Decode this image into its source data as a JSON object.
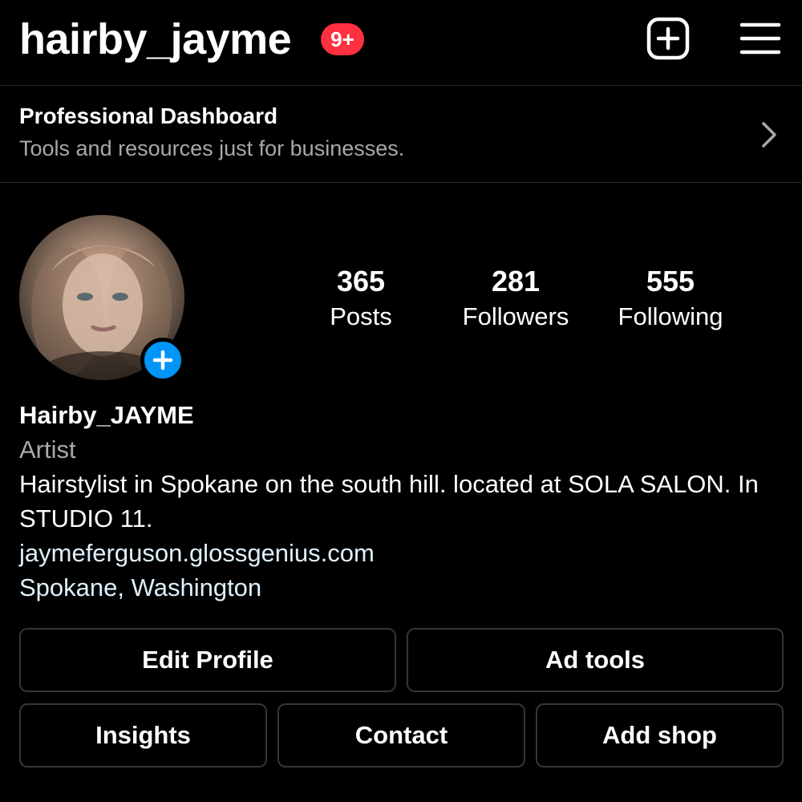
{
  "header": {
    "username": "hairby_jayme",
    "notification_badge": "9+",
    "badge_color": "#ff3040",
    "create_icon": "plus-square-icon",
    "menu_icon": "hamburger-menu-icon"
  },
  "dashboard": {
    "title": "Professional Dashboard",
    "subtitle": "Tools and resources just for businesses.",
    "chevron_icon": "chevron-right-icon"
  },
  "profile": {
    "avatar_icon": "profile-photo",
    "add_story_icon": "plus-circle-icon",
    "add_story_color": "#0095f6"
  },
  "stats": [
    {
      "count": "365",
      "label": "Posts"
    },
    {
      "count": "281",
      "label": "Followers"
    },
    {
      "count": "555",
      "label": "Following"
    }
  ],
  "bio": {
    "name": "Hairby_JAYME",
    "category": "Artist",
    "text": "Hairstylist in Spokane on the south hill. located at SOLA SALON. In STUDIO 11.",
    "link": "jaymeferguson.glossgenius.com",
    "location": "Spokane, Washington",
    "link_color": "#e0f1ff"
  },
  "buttons": {
    "edit_profile": "Edit Profile",
    "ad_tools": "Ad tools",
    "insights": "Insights",
    "contact": "Contact",
    "add_shop": "Add shop"
  }
}
